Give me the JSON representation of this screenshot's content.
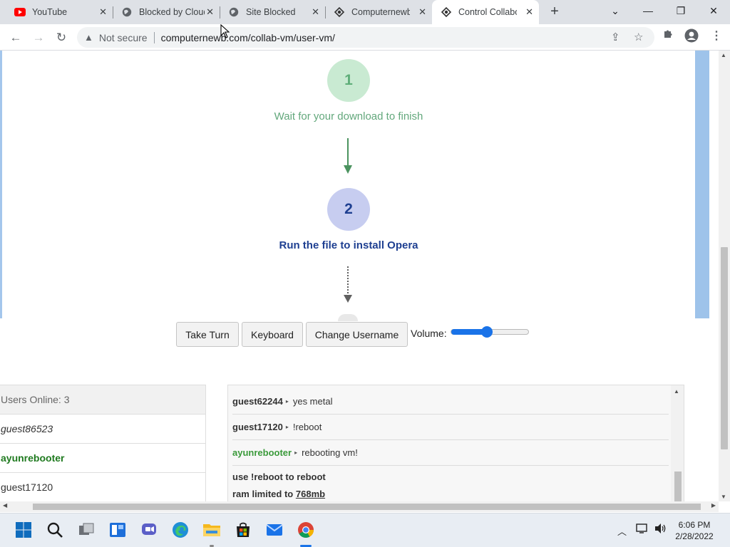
{
  "browser": {
    "tabs": [
      {
        "title": "YouTube",
        "icon": "youtube-icon",
        "active": false
      },
      {
        "title": "Blocked by Cloudflare",
        "icon": "globe-icon",
        "active": false
      },
      {
        "title": "Site Blocked",
        "icon": "globe-icon",
        "active": false
      },
      {
        "title": "Computernewb",
        "icon": "computernewb-icon",
        "active": false
      },
      {
        "title": "Control Collaborative",
        "icon": "computernewb-icon",
        "active": true
      }
    ],
    "security_label": "Not secure",
    "url": "computernewb.com/collab-vm/user-vm/"
  },
  "vm_screen": {
    "step1_number": "1",
    "step1_text": "Wait for your download to finish",
    "step2_number": "2",
    "step2_text": "Run the file to install Opera"
  },
  "controls": {
    "take_turn": "Take Turn",
    "keyboard": "Keyboard",
    "change_username": "Change Username",
    "volume_label": "Volume:",
    "volume_level": 0.45
  },
  "users": {
    "header": "Users Online: 3",
    "list": [
      {
        "name": "guest86523",
        "style": "guest-italic"
      },
      {
        "name": "ayunrebooter",
        "style": "admin"
      },
      {
        "name": "guest17120",
        "style": "normal"
      }
    ]
  },
  "chat": {
    "messages": [
      {
        "user": "guest62244",
        "text": "yes metal",
        "admin": false
      },
      {
        "user": "guest17120",
        "text": "!reboot",
        "admin": false
      },
      {
        "user": "ayunrebooter",
        "text": "rebooting vm!",
        "admin": true
      }
    ],
    "system_line1": "use !reboot to reboot",
    "system_line2_prefix": "ram limited to",
    "system_line2_link": "768mb"
  },
  "taskbar": {
    "time": "6:06 PM",
    "date": "2/28/2022"
  },
  "colors": {
    "accent": "#1a73e8",
    "step1_green": "#5fae79",
    "step2_navy": "#1e3f91",
    "admin_green": "#1f7a1f"
  }
}
